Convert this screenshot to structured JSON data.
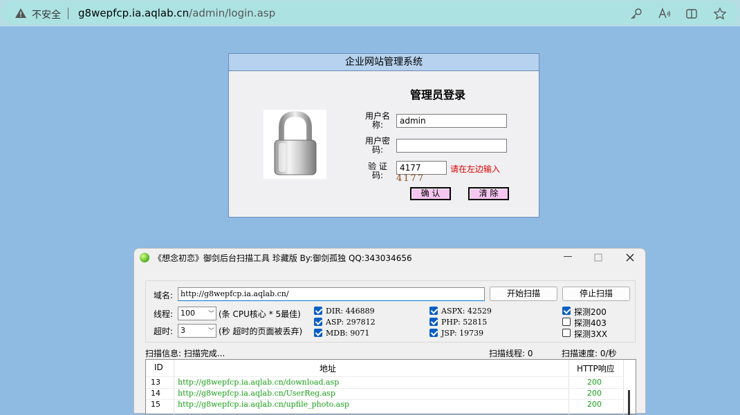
{
  "browser": {
    "security_label": "不安全",
    "url_host": "g8wepfcp.ia.aqlab.cn",
    "url_path": "/admin/login.asp"
  },
  "login": {
    "header": "企业网站管理系统",
    "title": "管理员登录",
    "username_label": "用户名称:",
    "username_value": "admin",
    "password_label": "用户密码:",
    "password_value": "",
    "captcha_label": "验 证 码:",
    "captcha_value": "4177",
    "captcha_hint": "请在左边输入",
    "captcha_image_text": "4177",
    "confirm_label": "确 认",
    "clear_label": "清 除"
  },
  "scanner": {
    "title": "《想念初恋》御剑后台扫描工具 珍藏版 By:御剑孤独 QQ:343034656",
    "domain_label": "域名:",
    "domain_value": "http://g8wepfcp.ia.aqlab.cn/",
    "start_label": "开始扫描",
    "stop_label": "停止扫描",
    "threads_label": "线程:",
    "threads_value": "100",
    "threads_hint": "(条 CPU核心 * 5最佳)",
    "timeout_label": "超时:",
    "timeout_value": "3",
    "timeout_hint": "(秒 超时的页面被丢弃)",
    "dicts": [
      {
        "label": "DIR: 446889",
        "checked": true
      },
      {
        "label": "ASP: 297812",
        "checked": true
      },
      {
        "label": "MDB: 9071",
        "checked": true
      },
      {
        "label": "ASPX: 42529",
        "checked": true
      },
      {
        "label": "PHP: 52815",
        "checked": true
      },
      {
        "label": "JSP: 19739",
        "checked": true
      }
    ],
    "probes": [
      {
        "label": "探测200",
        "checked": true
      },
      {
        "label": "探测403",
        "checked": false
      },
      {
        "label": "探测3XX",
        "checked": false
      }
    ],
    "status_info": "扫描信息: 扫描完成...",
    "status_threads": "扫描线程: 0",
    "status_speed": "扫描速度: 0/秒",
    "table": {
      "headers": [
        "ID",
        "地址",
        "HTTP响应"
      ],
      "rows": [
        {
          "id": "13",
          "url": "http://g8wepfcp.ia.aqlab.cn/download.asp",
          "code": "200"
        },
        {
          "id": "14",
          "url": "http://g8wepfcp.ia.aqlab.cn/UserReg.asp",
          "code": "200"
        },
        {
          "id": "15",
          "url": "http://g8wepfcp.ia.aqlab.cn/upfile_photo.asp",
          "code": "200"
        }
      ]
    }
  },
  "colors": {
    "page_bg": "#8fbbe3",
    "address_bar": "#ace3e2",
    "login_header": "#b6d2ee",
    "pink_button": "#f7c6f0",
    "hint_red": "#e00000",
    "result_green": "#1aa01a",
    "checkbox_blue": "#0a5fc4"
  }
}
